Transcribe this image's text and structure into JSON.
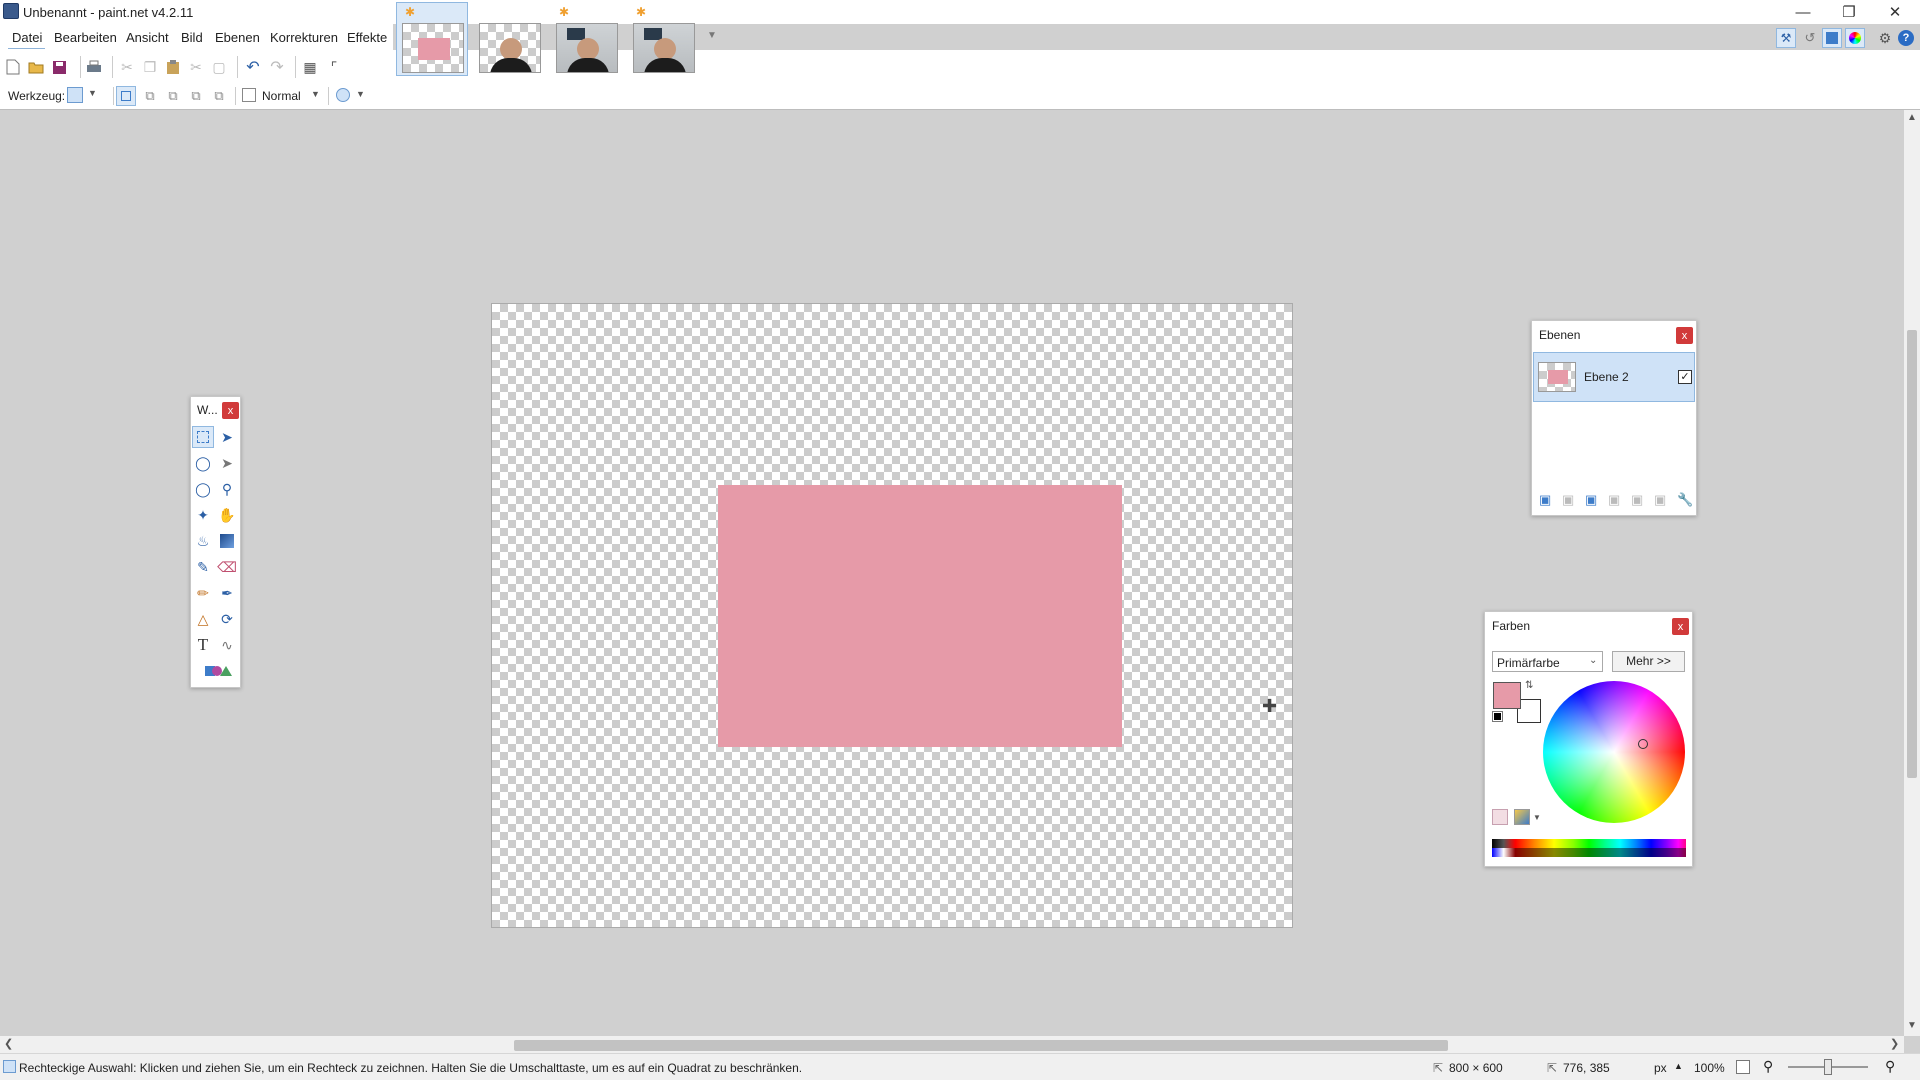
{
  "window": {
    "title": "Unbenannt - paint.net v4.2.11"
  },
  "menu": [
    "Datei",
    "Bearbeiten",
    "Ansicht",
    "Bild",
    "Ebenen",
    "Korrekturen",
    "Effekte"
  ],
  "toolbar2": {
    "tool_label": "Werkzeug:",
    "blend_mode": "Normal"
  },
  "tools_window": {
    "title": "W...",
    "close": "x"
  },
  "layers_window": {
    "title": "Ebenen",
    "close": "x",
    "layer_name": "Ebene 2"
  },
  "colors_window": {
    "title": "Farben",
    "close": "x",
    "dropdown": "Primärfarbe",
    "more_button": "Mehr >>",
    "primary_color": "#e69aa8"
  },
  "status": {
    "hint": "Rechteckige Auswahl: Klicken und ziehen Sie, um ein Rechteck zu zeichnen. Halten Sie die Umschalttaste, um es auf ein Quadrat zu beschränken.",
    "image_size": "800 × 600",
    "cursor_pos": "776, 385",
    "unit": "px",
    "zoom": "100%",
    "zoom_slider_fraction": 0.5
  }
}
